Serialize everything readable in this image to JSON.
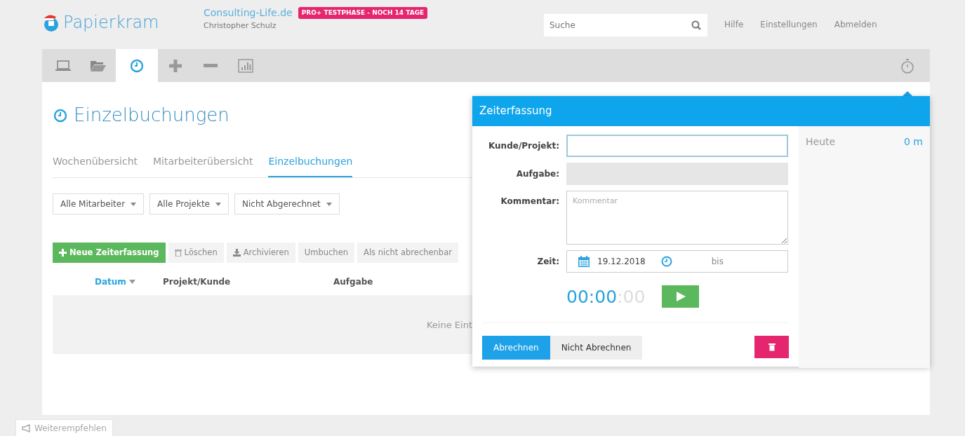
{
  "header": {
    "logo": "Papierkram",
    "company": "Consulting-Life.de",
    "badge": "PRO+ TESTPHASE - NOCH 14 TAGE",
    "user": "Christopher Schulz",
    "search": {
      "placeholder": "Suche"
    },
    "links": [
      "Hilfe",
      "Einstellungen",
      "Abmelden"
    ]
  },
  "toolbar": {
    "tabs": [
      {
        "kind": "laptop",
        "selected": false
      },
      {
        "kind": "folder",
        "selected": false
      },
      {
        "kind": "clock",
        "selected": true
      },
      {
        "kind": "plus",
        "selected": false
      },
      {
        "kind": "minus",
        "selected": false
      },
      {
        "kind": "chart",
        "selected": false
      }
    ]
  },
  "page": {
    "title": "Einzelbuchungen",
    "subtabs": [
      {
        "label": "Wochenübersicht",
        "selected": false
      },
      {
        "label": "Mitarbeiterübersicht",
        "selected": false
      },
      {
        "label": "Einzelbuchungen",
        "selected": true
      }
    ],
    "filters": [
      "Alle Mitarbeiter",
      "Alle Projekte",
      "Nicht Abgerechnet"
    ],
    "actions": [
      {
        "label": "Neue Zeiterfassung",
        "kind": "primary"
      },
      {
        "label": "Löschen",
        "kind": "trash"
      },
      {
        "label": "Archivieren",
        "kind": "download"
      },
      {
        "label": "Umbuchen",
        "kind": "plain"
      },
      {
        "label": "Als nicht abrechenbar",
        "kind": "plain"
      }
    ],
    "table": {
      "columns": [
        {
          "label": "Datum",
          "sorted": true
        },
        {
          "label": "Projekt/Kunde",
          "sorted": false
        },
        {
          "label": "Aufgabe",
          "sorted": false
        }
      ],
      "empty": "Keine Eint"
    }
  },
  "popover": {
    "title": "Zeiterfassung",
    "fields": [
      {
        "label": "Kunde/Projekt:",
        "kind": "text"
      },
      {
        "label": "Aufgabe:",
        "kind": "disabled"
      },
      {
        "label": "Kommentar:",
        "kind": "textarea",
        "placeholder": "Kommentar"
      },
      {
        "label": "Zeit:",
        "kind": "time",
        "date": "19.12.2018",
        "until": "bis"
      }
    ],
    "timer": {
      "main": "00:00",
      "seconds": ":00"
    },
    "buttons": [
      {
        "label": "Abrechnen",
        "selected": true
      },
      {
        "label": "Nicht Abrechnen",
        "selected": false
      }
    ],
    "today": {
      "label": "Heute",
      "value": "0 m"
    }
  },
  "feedback": "Weiterempfehlen"
}
